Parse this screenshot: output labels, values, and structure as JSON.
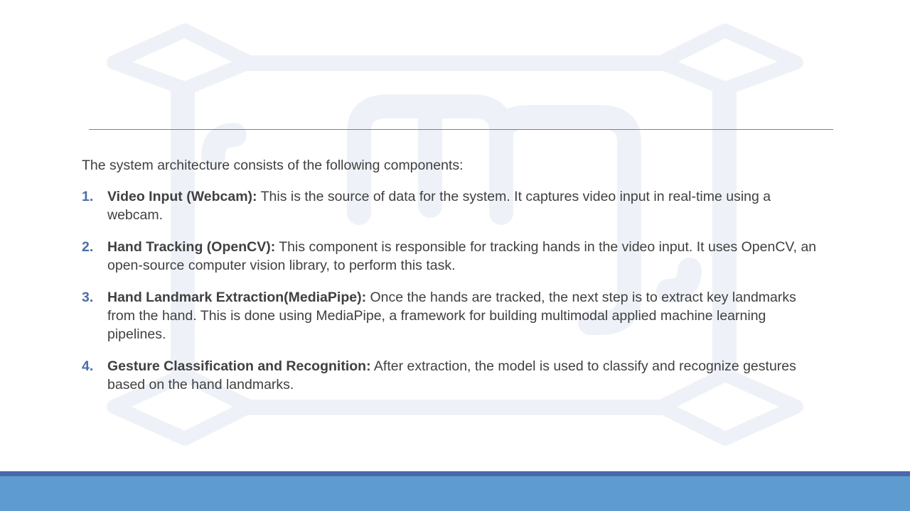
{
  "intro": "The system architecture consists of the following components:",
  "items": [
    {
      "number": "1.",
      "label": "Video Input (Webcam):",
      "text": " This is the source of data for the system. It captures video input in real-time using a webcam."
    },
    {
      "number": "2.",
      "label": "Hand Tracking (OpenCV):",
      "text": " This component is responsible for tracking hands in the video input. It uses OpenCV, an open-source computer vision library, to perform this task."
    },
    {
      "number": "3.",
      "label": "Hand Landmark Extraction(MediaPipe):",
      "text": " Once the hands are tracked, the next step is to extract key landmarks from the hand. This is done using MediaPipe, a framework for building multimodal applied machine learning pipelines."
    },
    {
      "number": "4.",
      "label": "Gesture Classification and Recognition:",
      "text": " After extraction, the model is used to classify and recognize gestures based on the hand landmarks."
    }
  ],
  "colors": {
    "text": "#404040",
    "number": "#4a6fa5",
    "footer_stripe": "#4a67ac",
    "footer_bar": "#5e9bd0",
    "watermark": "#eef2f8"
  }
}
